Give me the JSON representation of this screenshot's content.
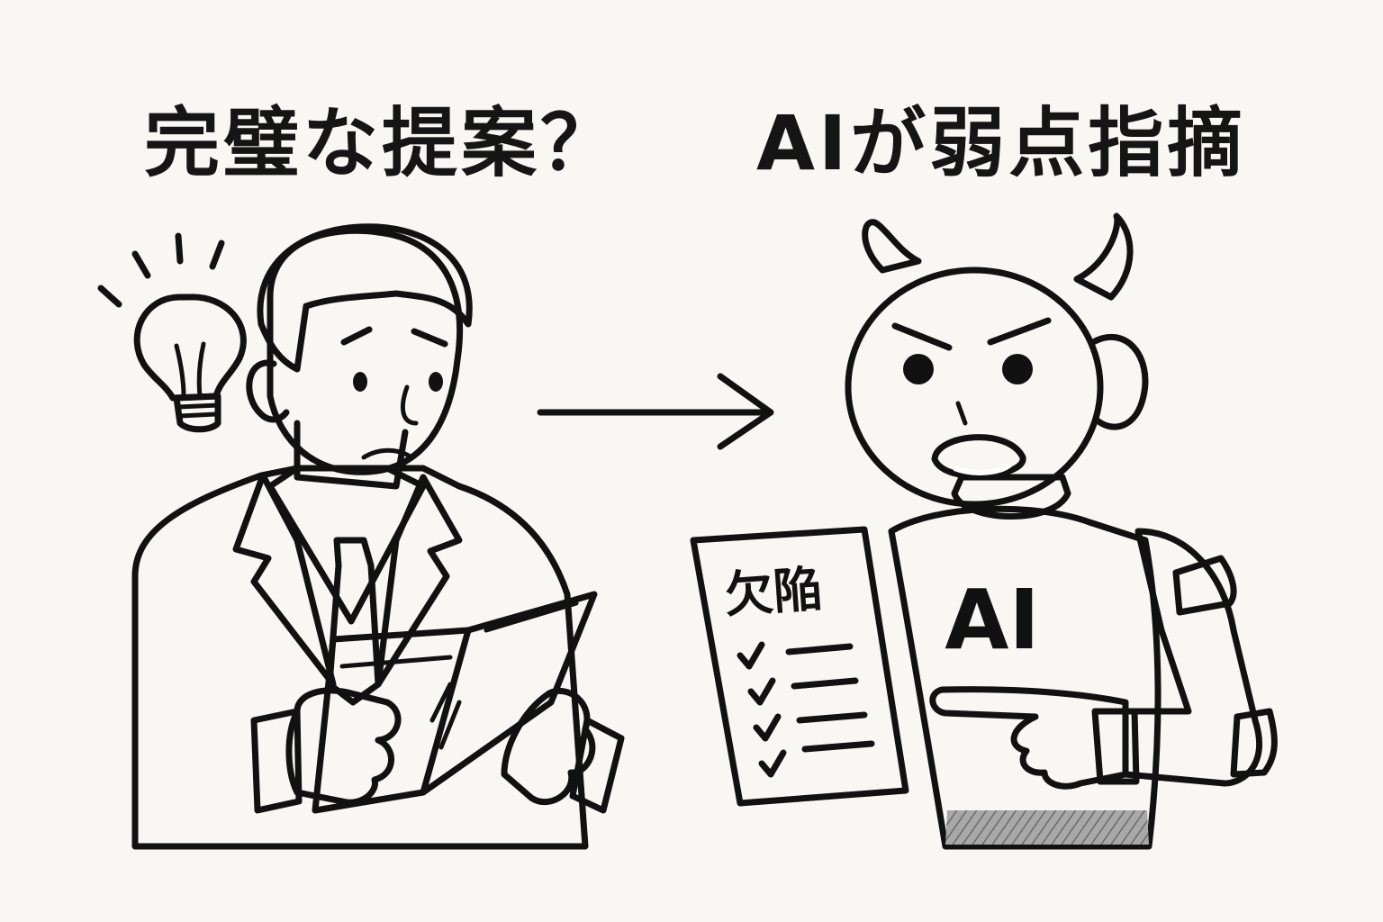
{
  "captions": {
    "left": "完璧な提案？",
    "right": "AIが弱点指摘"
  },
  "robot": {
    "chest_label": "AI"
  },
  "document": {
    "heading": "欠陥",
    "checklist_items": 4
  },
  "colors": {
    "background": "#f8f7f4",
    "ink": "#111111",
    "shading": "#555555"
  },
  "icons": [
    "lightbulb-icon",
    "arrow-right-icon",
    "checkmark-icon"
  ]
}
